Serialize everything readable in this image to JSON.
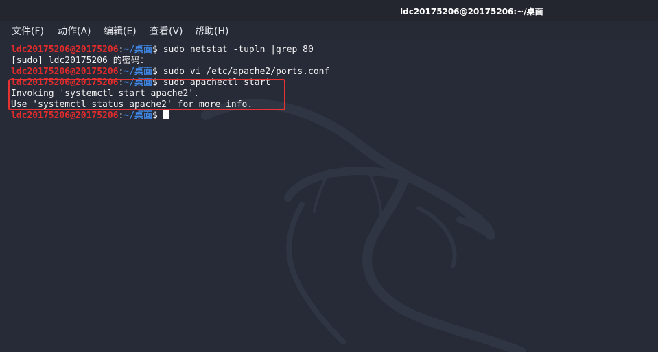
{
  "window": {
    "title": "ldc20175206@20175206:~/桌面"
  },
  "menu": [
    {
      "id": "file",
      "label": "文件(F)"
    },
    {
      "id": "action",
      "label": "动作(A)"
    },
    {
      "id": "edit",
      "label": "编辑(E)"
    },
    {
      "id": "view",
      "label": "查看(V)"
    },
    {
      "id": "help",
      "label": "帮助(H)"
    }
  ],
  "prompt": {
    "user_host": "ldc20175206@20175206",
    "colon": ":",
    "path": "~/桌面",
    "symbol": "$"
  },
  "terminal": {
    "lines": [
      {
        "command": "sudo netstat -tupln |grep 80"
      },
      {
        "output": "[sudo] ldc20175206 的密码："
      },
      {
        "command": "sudo vi /etc/apache2/ports.conf"
      },
      {
        "command": "sudo apachectl start"
      },
      {
        "output": "Invoking 'systemctl start apache2'."
      },
      {
        "output": "Use 'systemctl status apache2' for more info."
      },
      {
        "command": ""
      }
    ]
  },
  "colors": {
    "background": "#272b37",
    "prompt_user": "#e32b2b",
    "prompt_path": "#3f88e6",
    "text": "#f2f2f2",
    "highlight_box": "#e53232"
  }
}
